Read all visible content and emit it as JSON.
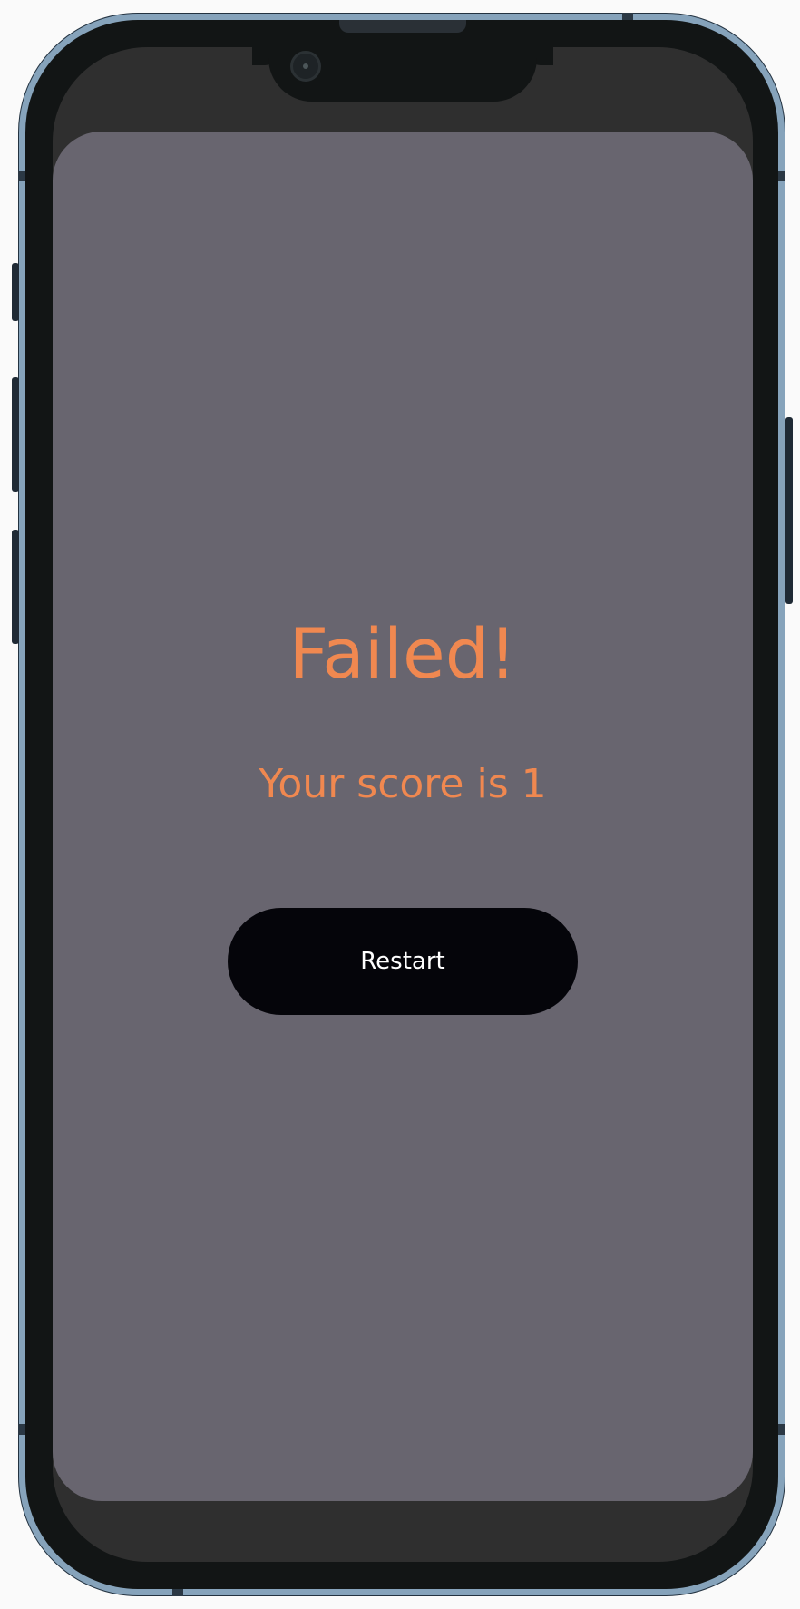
{
  "game_over": {
    "title": "Failed!",
    "score_text": "Your score is 1",
    "restart_label": "Restart"
  },
  "colors": {
    "accent": "#f08850",
    "screen_background": "#68656f",
    "button_background": "#05050a",
    "button_text": "#ffffff",
    "device_frame": "#86a3bb"
  }
}
